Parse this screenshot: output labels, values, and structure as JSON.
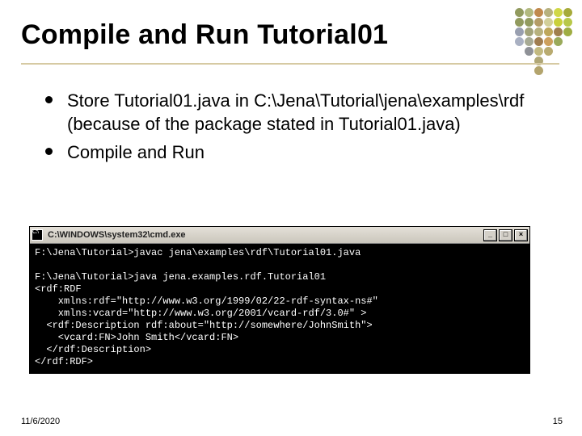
{
  "title": "Compile and Run Tutorial01",
  "bullets": [
    "Store Tutorial01.java in C:\\Jena\\Tutorial\\jena\\examples\\rdf (because of the package stated in Tutorial01.java)",
    "Compile and Run"
  ],
  "cmd": {
    "caption": "C:\\WINDOWS\\system32\\cmd.exe",
    "buttons": {
      "min": "_",
      "max": "□",
      "close": "×"
    },
    "lines": [
      "F:\\Jena\\Tutorial>javac jena\\examples\\rdf\\Tutorial01.java",
      "",
      "F:\\Jena\\Tutorial>java jena.examples.rdf.Tutorial01",
      "<rdf:RDF",
      "    xmlns:rdf=\"http://www.w3.org/1999/02/22-rdf-syntax-ns#\"",
      "    xmlns:vcard=\"http://www.w3.org/2001/vcard-rdf/3.0#\" >",
      "  <rdf:Description rdf:about=\"http://somewhere/JohnSmith\">",
      "    <vcard:FN>John Smith</vcard:FN>",
      "  </rdf:Description>",
      "</rdf:RDF>"
    ]
  },
  "footer": {
    "date": "11/6/2020",
    "page": "15"
  },
  "deco_colors": [
    "#919a5e",
    "#b2b97f",
    "#c0894d",
    "#b7b17e",
    "#d0d747",
    "#a6aa3a",
    "#919a5e",
    "#929b5f",
    "#b49c67",
    "#d2cf9a",
    "#c9d03b",
    "#b8c849",
    "#999fb0",
    "#a2a37a",
    "#b7b17e",
    "#bea75b",
    "#a07f4e",
    "#9fad43",
    "#a9b0c2",
    "#a7aa94",
    "#a07d50",
    "#cda05d",
    "#9aaa5b",
    "",
    "",
    "#8f9197",
    "#c2b97f",
    "#b9ab70",
    "",
    "",
    "",
    "",
    "#b0a776",
    "",
    "",
    "",
    "",
    "",
    "#b3a46d",
    "",
    "",
    ""
  ]
}
